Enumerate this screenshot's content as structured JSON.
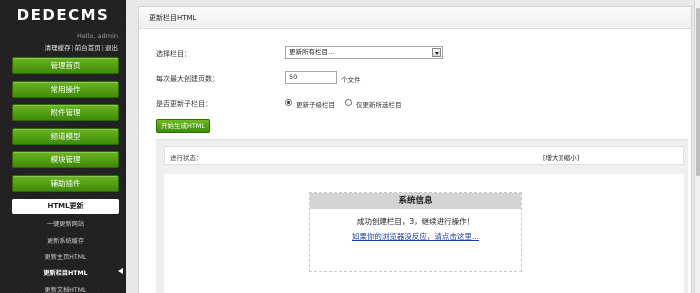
{
  "brand": {
    "logo": "DEDECMS",
    "greeting": "Hello, admin"
  },
  "toplinks": [
    "清理缓存",
    "前台首页",
    "退出"
  ],
  "menu": [
    {
      "label": "管理首页"
    },
    {
      "label": "常用操作"
    },
    {
      "label": "附件管理"
    },
    {
      "label": "频道模型"
    },
    {
      "label": "模块管理"
    },
    {
      "label": "辅助插件"
    }
  ],
  "menu_active": {
    "label": "HTML更新"
  },
  "submenu": [
    {
      "label": "一键更新网站"
    },
    {
      "label": "更新系统缓存"
    },
    {
      "label": "更新主页HTML"
    },
    {
      "label": "更新栏目HTML"
    },
    {
      "label": "更新文档HTML"
    }
  ],
  "panel": {
    "title": "更新栏目HTML",
    "select_label": "选择栏目：",
    "select_value": "更新所有栏目...",
    "pages_label": "每次最大创建页数：",
    "pages_value": "50",
    "pages_unit": "个文件",
    "subcat_label": "是否更新子栏目：",
    "radio_options": [
      {
        "label": "更新子级栏目",
        "checked": true
      },
      {
        "label": "仅更新所选栏目",
        "checked": false
      }
    ],
    "start_button": "开始生成HTML"
  },
  "status": {
    "label": "进行状态：",
    "enlarge": "[增大]",
    "shrink": "[缩小]"
  },
  "sysinfo": {
    "title": "系统信息",
    "message": "成功创建栏目，3，继续进行操作！",
    "link": "如果你的浏览器没反应，请点击这里..."
  },
  "colors": {
    "sidebar_bg": "#1f1f1f",
    "menu_green": "#4f9e14",
    "link_blue": "#1c3f9c"
  },
  "icons": {
    "active_arrow": "triangle-left",
    "select_arrow": "triangle-down"
  }
}
